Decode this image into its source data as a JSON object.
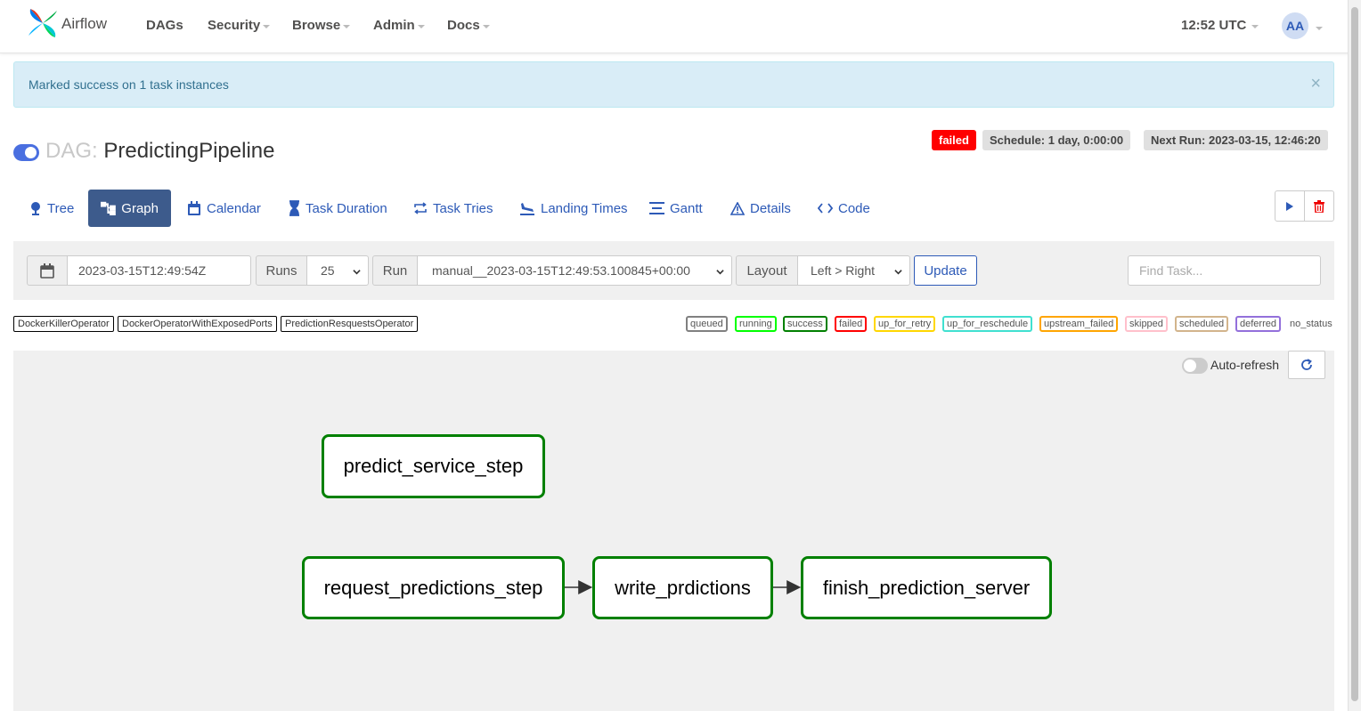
{
  "navbar": {
    "brand": "Airflow",
    "items": [
      "DAGs",
      "Security",
      "Browse",
      "Admin",
      "Docs"
    ],
    "time": "12:52 UTC",
    "avatar": "AA"
  },
  "alert": {
    "message": "Marked success on 1 task instances",
    "close": "×"
  },
  "dag": {
    "prefix": "DAG:",
    "name": "PredictingPipeline",
    "status": "failed",
    "schedule": "Schedule: 1 day, 0:00:00",
    "next_run": "Next Run: 2023-03-15, 12:46:20"
  },
  "tabs": [
    "Tree",
    "Graph",
    "Calendar",
    "Task Duration",
    "Task Tries",
    "Landing Times",
    "Gantt",
    "Details",
    "Code"
  ],
  "active_tab": "Graph",
  "form": {
    "date": "2023-03-15T12:49:54Z",
    "runs_label": "Runs",
    "runs_value": "25",
    "run_label": "Run",
    "run_value": "manual__2023-03-15T12:49:53.100845+00:00",
    "layout_label": "Layout",
    "layout_value": "Left > Right",
    "update": "Update",
    "find_placeholder": "Find Task..."
  },
  "operators": [
    "DockerKillerOperator",
    "DockerOperatorWithExposedPorts",
    "PredictionResquestsOperator"
  ],
  "states": [
    {
      "label": "queued",
      "color": "#808080"
    },
    {
      "label": "running",
      "color": "#00ff00"
    },
    {
      "label": "success",
      "color": "#008000"
    },
    {
      "label": "failed",
      "color": "#ff0000"
    },
    {
      "label": "up_for_retry",
      "color": "#ffd700"
    },
    {
      "label": "up_for_reschedule",
      "color": "#40e0d0"
    },
    {
      "label": "upstream_failed",
      "color": "#ffa500"
    },
    {
      "label": "skipped",
      "color": "#ffc0cb"
    },
    {
      "label": "scheduled",
      "color": "#d2b48c"
    },
    {
      "label": "deferred",
      "color": "#9370db"
    }
  ],
  "no_status": "no_status",
  "graph": {
    "auto_refresh": "Auto-refresh",
    "nodes": [
      "predict_service_step",
      "request_predictions_step",
      "write_prdictions",
      "finish_prediction_server"
    ],
    "node_state": "success"
  }
}
